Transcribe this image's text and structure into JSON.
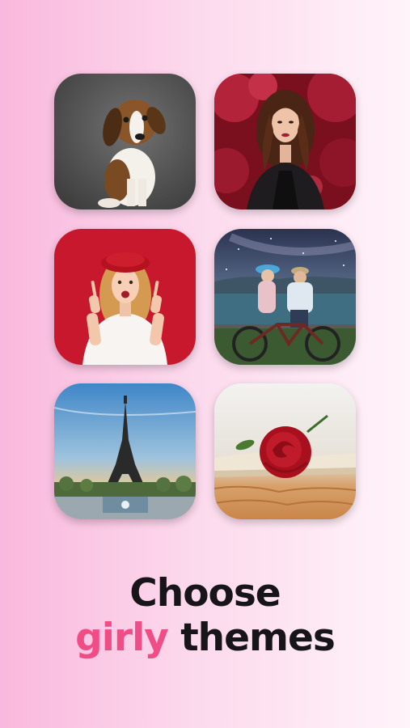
{
  "headline": {
    "line1": "Choose",
    "accent_word": "girly",
    "rest_word": "themes"
  },
  "colors": {
    "accent": "#f04d86",
    "text": "#17141a",
    "background_start": "#f9b8dd",
    "background_end": "#fff4fa"
  },
  "themes": [
    {
      "subject": "beagle-puppy"
    },
    {
      "subject": "woman-red-leaves"
    },
    {
      "subject": "girl-red-beret"
    },
    {
      "subject": "couple-bicycle-night-sky"
    },
    {
      "subject": "eiffel-tower"
    },
    {
      "subject": "red-rose-book"
    }
  ]
}
